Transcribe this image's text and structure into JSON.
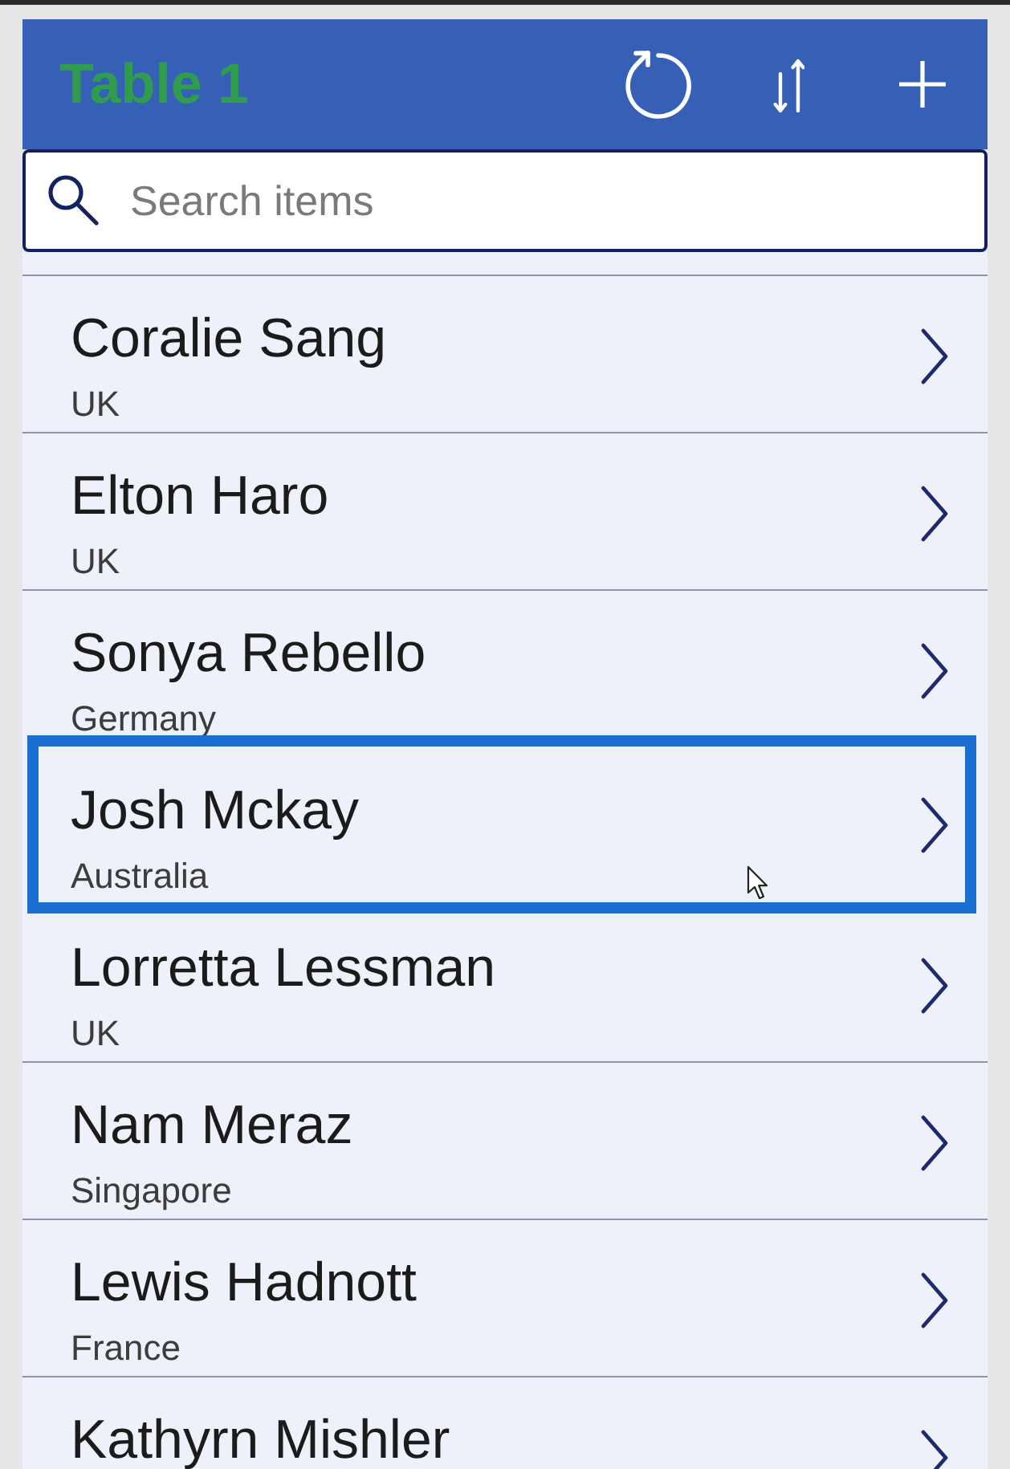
{
  "header": {
    "title": "Table 1"
  },
  "search": {
    "placeholder": "Search items"
  },
  "items": [
    {
      "name": "Coralie Sang",
      "country": "UK",
      "selected": false
    },
    {
      "name": "Elton Haro",
      "country": "UK",
      "selected": false
    },
    {
      "name": "Sonya Rebello",
      "country": "Germany",
      "selected": false
    },
    {
      "name": "Josh Mckay",
      "country": "Australia",
      "selected": true
    },
    {
      "name": "Lorretta Lessman",
      "country": "UK",
      "selected": false
    },
    {
      "name": "Nam Meraz",
      "country": "Singapore",
      "selected": false
    },
    {
      "name": "Lewis Hadnott",
      "country": "France",
      "selected": false
    },
    {
      "name": "Kathyrn Mishler",
      "selected": false
    }
  ]
}
